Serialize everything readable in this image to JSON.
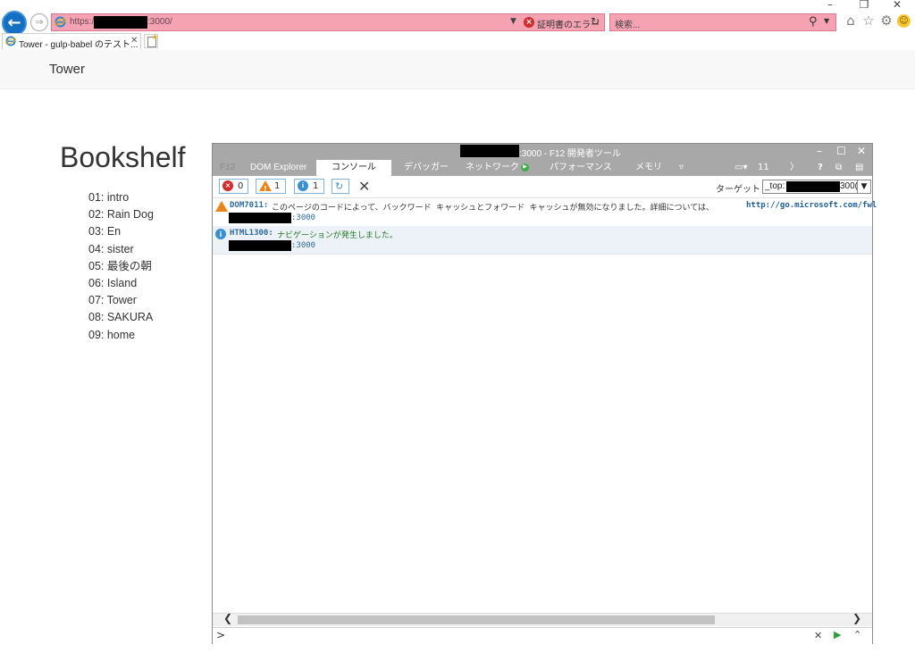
{
  "browser": {
    "url_prefix": "https://",
    "url_suffix": ":3000/",
    "cert_error": "証明書のエラー",
    "search_placeholder": "検索...",
    "tab_title": "Tower - gulp-babel のテスト...",
    "window_controls": [
      "–",
      "❐",
      "✕"
    ],
    "toolbar_icons": [
      "home-icon",
      "favorites-star-icon",
      "settings-gear-icon",
      "feedback-smiley-icon"
    ]
  },
  "page": {
    "brand": "Tower",
    "heading": "Bookshelf",
    "books": [
      "01: intro",
      "02: Rain Dog",
      "03: En",
      "04: sister",
      "05: 最後の朝",
      "06: Island",
      "07: Tower",
      "08: SAKURA",
      "09: home"
    ]
  },
  "devtools": {
    "title_suffix": ":3000 - F12 開発者ツール",
    "tabs": [
      "F12",
      "DOM Explorer",
      "コンソール",
      "デバッガー",
      "ネットワーク",
      "パフォーマンス",
      "メモリ"
    ],
    "active_tab": "コンソール",
    "emulation_count": "11",
    "help_label": "?",
    "filters": {
      "errors": "0",
      "warnings": "1",
      "info": "1"
    },
    "target_label": "ターゲット",
    "target_value_prefix": "_top:",
    "target_value_suffix": "300(",
    "messages": [
      {
        "level": "warning",
        "code": "DOM7011:",
        "text": "このページのコードによって、バックワード キャッシュとフォワード キャッシュが無効になりました。詳細については、",
        "link": "http://go.microsoft.com/fwl",
        "source": ":3000"
      },
      {
        "level": "info",
        "code": "HTML1300:",
        "text": "ナビゲーションが発生しました。",
        "source": ":3000"
      }
    ],
    "prompt": ">"
  },
  "colors": {
    "address_bar_error": "#f5a3b3",
    "back_button": "#1570c4",
    "devtools_chrome": "#a8a8a8",
    "warning": "#e8841a",
    "info": "#3a8fd1",
    "error": "#d22c2c",
    "success_green": "#237a23"
  }
}
